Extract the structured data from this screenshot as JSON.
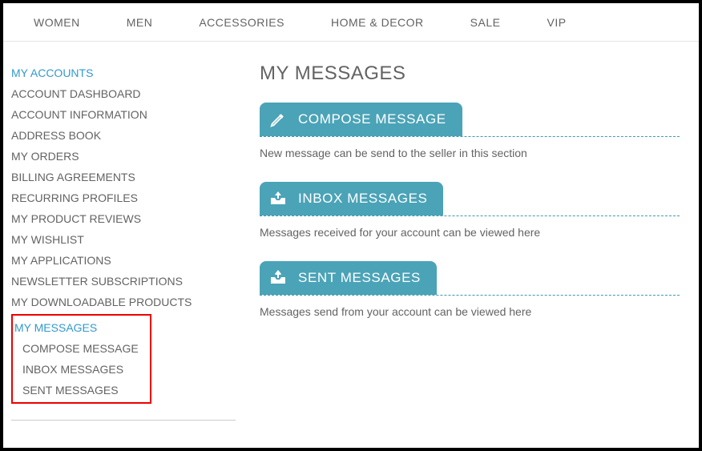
{
  "topnav": {
    "items": [
      {
        "label": "WOMEN"
      },
      {
        "label": "MEN"
      },
      {
        "label": "ACCESSORIES"
      },
      {
        "label": "HOME & DECOR"
      },
      {
        "label": "SALE"
      },
      {
        "label": "VIP"
      }
    ]
  },
  "sidebar": {
    "items": [
      {
        "label": "MY ACCOUNTS"
      },
      {
        "label": "ACCOUNT DASHBOARD"
      },
      {
        "label": "ACCOUNT INFORMATION"
      },
      {
        "label": "ADDRESS BOOK"
      },
      {
        "label": "MY ORDERS"
      },
      {
        "label": "BILLING AGREEMENTS"
      },
      {
        "label": "RECURRING PROFILES"
      },
      {
        "label": "MY PRODUCT REVIEWS"
      },
      {
        "label": "MY WISHLIST"
      },
      {
        "label": "MY APPLICATIONS"
      },
      {
        "label": "NEWSLETTER SUBSCRIPTIONS"
      },
      {
        "label": "MY DOWNLOADABLE PRODUCTS"
      }
    ],
    "messages_section": {
      "heading": "MY MESSAGES",
      "children": [
        {
          "label": "COMPOSE MESSAGE"
        },
        {
          "label": "INBOX MESSAGES"
        },
        {
          "label": "SENT MESSAGES"
        }
      ]
    }
  },
  "main": {
    "title": "MY MESSAGES",
    "blocks": [
      {
        "label": "COMPOSE MESSAGE",
        "desc": "New message can be send to the seller in this section",
        "icon": "pencil-icon"
      },
      {
        "label": "INBOX MESSAGES",
        "desc": "Messages received for your account can be viewed here",
        "icon": "inbox-icon"
      },
      {
        "label": "SENT MESSAGES",
        "desc": "Messages send from your account can be viewed here",
        "icon": "outbox-icon"
      }
    ]
  }
}
